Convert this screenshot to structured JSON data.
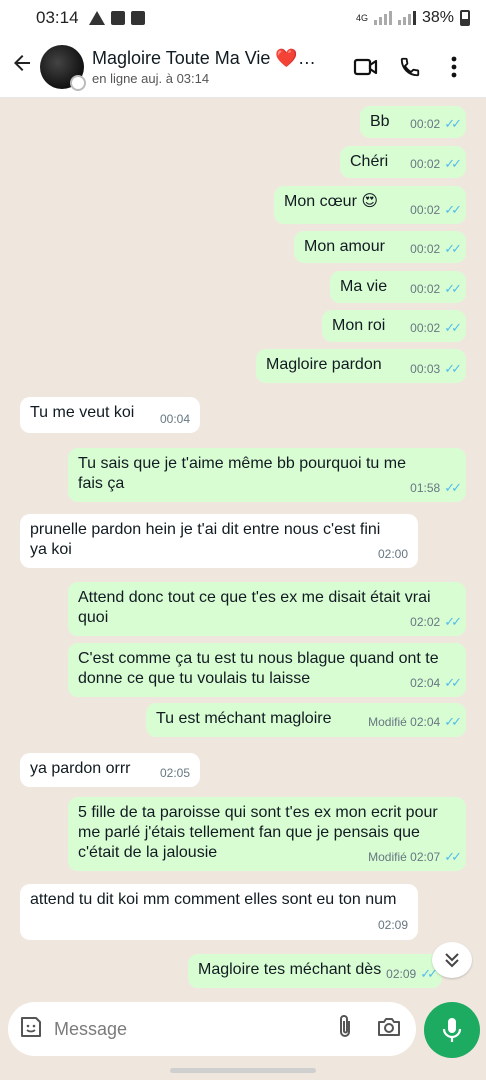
{
  "status_bar": {
    "time": "03:14",
    "network": "4G",
    "battery": "38%"
  },
  "header": {
    "contact_name": "Magloire Toute Ma Vie ❤️🥰...",
    "presence": "en ligne auj. à 03:14"
  },
  "messages": [
    {
      "dir": "out",
      "text": "Bb",
      "time": "00:02",
      "edited": ""
    },
    {
      "dir": "out",
      "text": "Chéri",
      "time": "00:02",
      "edited": ""
    },
    {
      "dir": "out",
      "text": "Mon cœur 😍",
      "time": "00:02",
      "edited": ""
    },
    {
      "dir": "out",
      "text": "Mon amour",
      "time": "00:02",
      "edited": ""
    },
    {
      "dir": "out",
      "text": "Ma vie",
      "time": "00:02",
      "edited": ""
    },
    {
      "dir": "out",
      "text": "Mon roi",
      "time": "00:02",
      "edited": ""
    },
    {
      "dir": "out",
      "text": "Magloire pardon",
      "time": "00:03",
      "edited": ""
    },
    {
      "dir": "in",
      "text": "Tu me veut koi",
      "time": "00:04",
      "edited": ""
    },
    {
      "dir": "out",
      "text": "Tu sais que je t'aime même bb pourquoi tu me fais ça",
      "time": "01:58",
      "edited": ""
    },
    {
      "dir": "in",
      "text": "prunelle pardon hein je t'ai dit entre nous c'est fini ya koi",
      "time": "02:00",
      "edited": ""
    },
    {
      "dir": "out",
      "text": "Attend donc tout ce que t'es ex me disait était vrai quoi",
      "time": "02:02",
      "edited": ""
    },
    {
      "dir": "out",
      "text": "C'est comme ça tu est tu nous blague quand ont te donne ce que tu voulais tu laisse",
      "time": "02:04",
      "edited": ""
    },
    {
      "dir": "out",
      "text": "Tu est méchant magloire",
      "time": "02:04",
      "edited": "Modifié"
    },
    {
      "dir": "in",
      "text": "ya pardon orrr",
      "time": "02:05",
      "edited": ""
    },
    {
      "dir": "out",
      "text": "5 fille de ta paroisse qui sont  t'es ex  mon ecrit pour me parlé j'étais tellement fan que je pensais que c'était de la jalousie",
      "time": "02:07",
      "edited": "Modifié"
    },
    {
      "dir": "in",
      "text": "attend tu dit koi mm comment elles sont eu ton num",
      "time": "02:09",
      "edited": ""
    },
    {
      "dir": "out",
      "text": "Magloire tes méchant dès",
      "time": "02:09",
      "edited": ""
    }
  ],
  "composer": {
    "placeholder": "Message"
  },
  "colors": {
    "outgoing": "#d9fdd3",
    "incoming": "#ffffff",
    "read_ticks": "#53bdeb",
    "accent": "#1daa61"
  }
}
